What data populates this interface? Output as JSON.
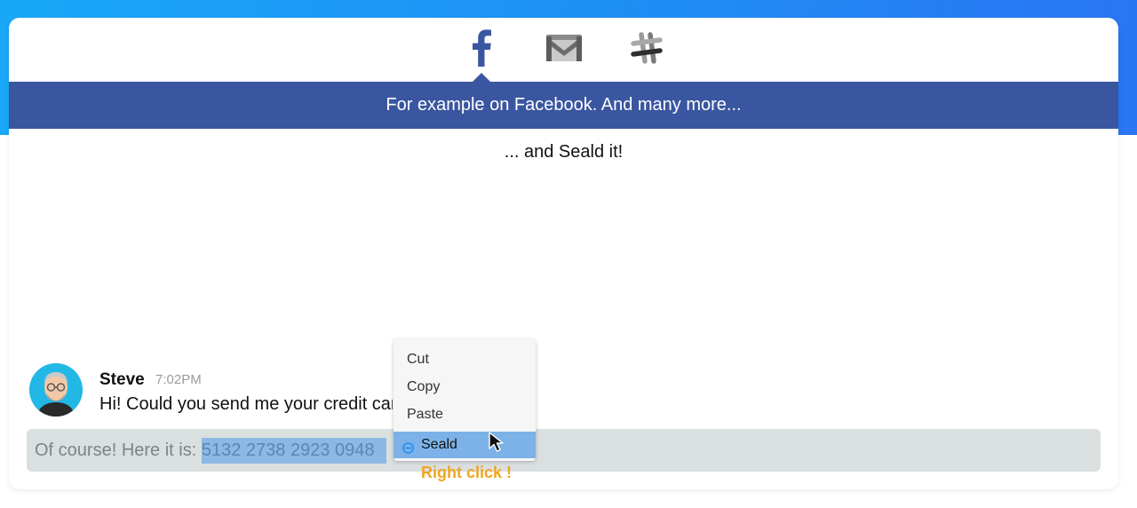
{
  "tabs": [
    {
      "name": "facebook",
      "icon": "facebook-icon"
    },
    {
      "name": "gmail",
      "icon": "gmail-icon"
    },
    {
      "name": "slack",
      "icon": "slack-icon"
    }
  ],
  "banner": {
    "text": "For example on Facebook. And many more..."
  },
  "subtitle": "... and Seald it!",
  "chat": {
    "sender": "Steve",
    "time": "7:02PM",
    "message": "Hi! Could you send me your credit card",
    "reply_prefix": "Of course! Here it is: ",
    "selected_text": "5132 2738 2923 0948"
  },
  "context_menu": {
    "items": [
      "Cut",
      "Copy",
      "Paste",
      "Seald"
    ]
  },
  "hint": "Right click !",
  "colors": {
    "facebook_blue": "#3a56a0",
    "selection": "#8cb9e3",
    "menu_highlight": "#7cb2e8",
    "hint": "#f0a520"
  }
}
